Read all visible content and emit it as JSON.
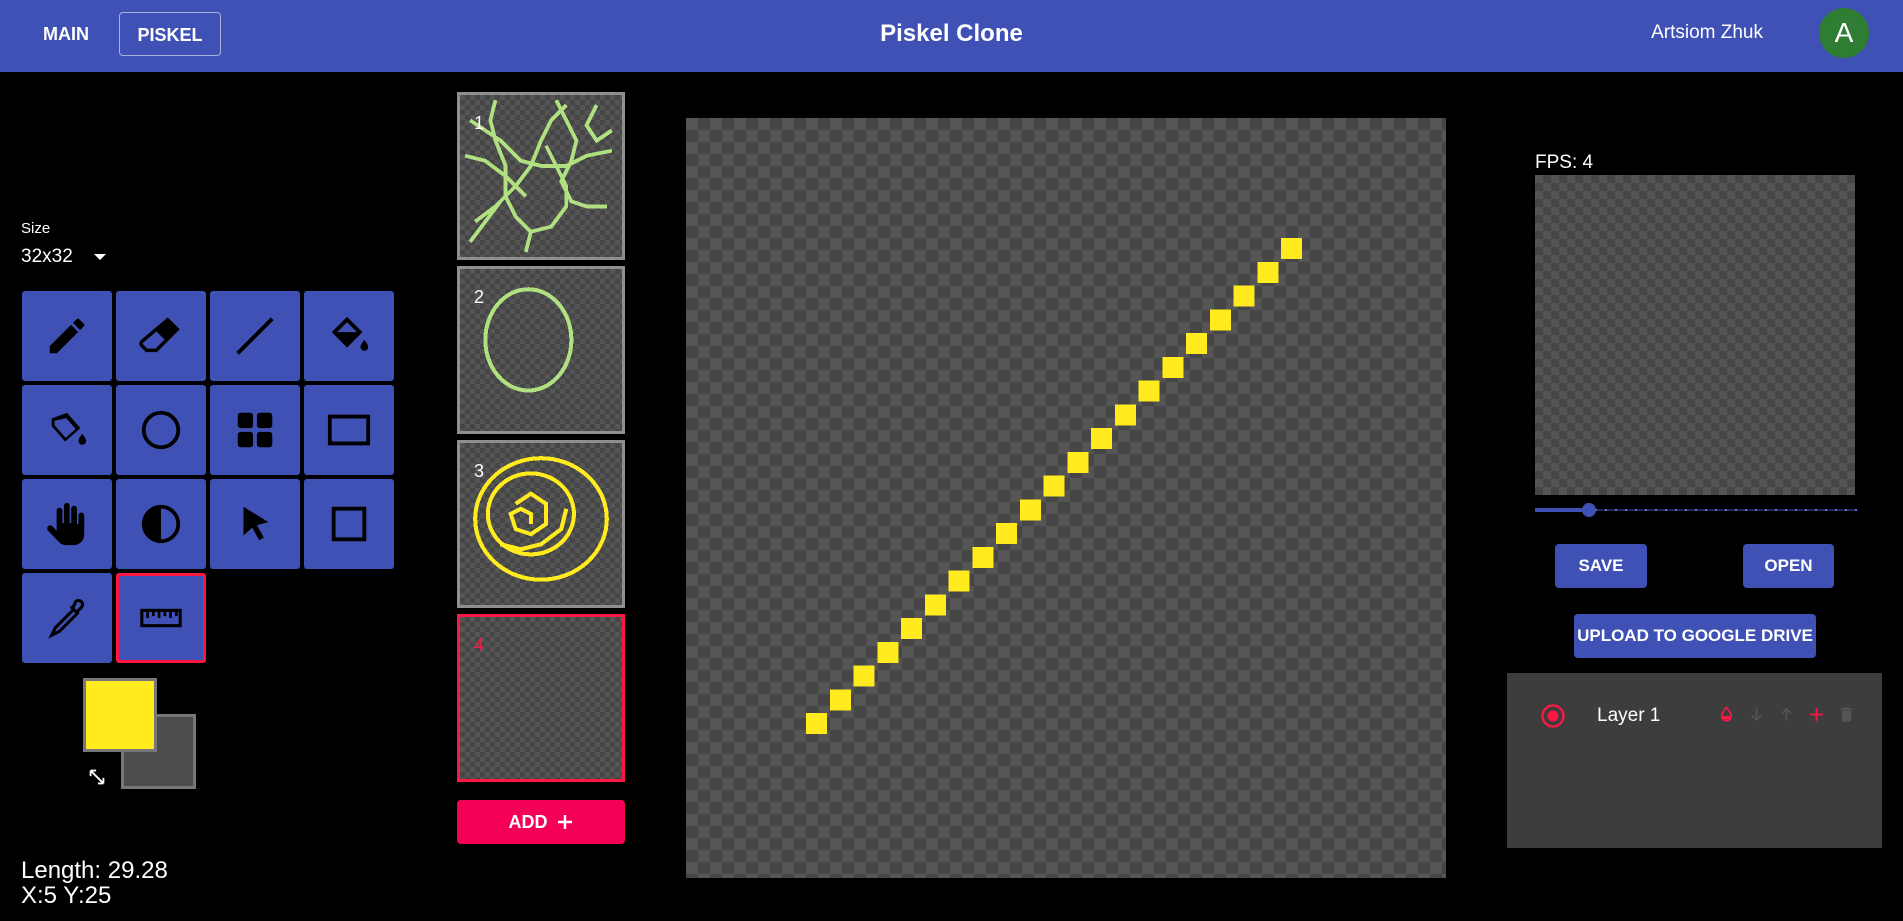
{
  "header": {
    "nav": [
      {
        "label": "MAIN"
      },
      {
        "label": "PISKEL"
      }
    ],
    "title": "Piskel Clone",
    "user_name": "Artsiom Zhuk",
    "avatar_initial": "A",
    "avatar_color": "#2e7d32",
    "bar_color": "#3f51b5"
  },
  "tools": {
    "size_label": "Size",
    "size_value": "32x32",
    "items": [
      {
        "name": "pen",
        "icon": "pencil-icon",
        "active": false
      },
      {
        "name": "eraser",
        "icon": "eraser-icon",
        "active": false
      },
      {
        "name": "stroke",
        "icon": "line-icon",
        "active": false
      },
      {
        "name": "paint-bucket",
        "icon": "paint-bucket-icon",
        "active": false
      },
      {
        "name": "paint-all-same",
        "icon": "paint-pour-icon",
        "active": false
      },
      {
        "name": "circle",
        "icon": "circle-icon",
        "active": false
      },
      {
        "name": "dithering",
        "icon": "grid-squares-icon",
        "active": false
      },
      {
        "name": "rectangle",
        "icon": "rectangle-icon",
        "active": false
      },
      {
        "name": "move",
        "icon": "hand-icon",
        "active": false
      },
      {
        "name": "lighten",
        "icon": "contrast-icon",
        "active": false
      },
      {
        "name": "select",
        "icon": "cursor-icon",
        "active": false
      },
      {
        "name": "rectangle-select",
        "icon": "selection-square-icon",
        "active": false
      },
      {
        "name": "color-picker",
        "icon": "eyedropper-icon",
        "active": false
      },
      {
        "name": "ruler",
        "icon": "ruler-icon",
        "active": true
      }
    ],
    "primary_color": "#ffeb1e",
    "secondary_color": "#4c4c4c"
  },
  "status": {
    "length": "Length: 29.28",
    "coords": "X:5 Y:25"
  },
  "frames": {
    "items": [
      {
        "number": "1",
        "active": false
      },
      {
        "number": "2",
        "active": false
      },
      {
        "number": "3",
        "active": false
      },
      {
        "number": "4",
        "active": true
      }
    ],
    "add_label": "ADD"
  },
  "canvas": {
    "grid": 32,
    "stroke_color": "#ffeb1e",
    "pixels": [
      [
        5,
        25
      ],
      [
        6,
        24
      ],
      [
        7,
        23
      ],
      [
        8,
        22
      ],
      [
        9,
        21
      ],
      [
        10,
        20
      ],
      [
        11,
        19
      ],
      [
        12,
        18
      ],
      [
        13,
        17
      ],
      [
        14,
        16
      ],
      [
        15,
        15
      ],
      [
        16,
        14
      ],
      [
        17,
        13
      ],
      [
        18,
        12
      ],
      [
        19,
        11
      ],
      [
        20,
        10
      ],
      [
        21,
        9
      ],
      [
        22,
        8
      ],
      [
        23,
        7
      ],
      [
        24,
        6
      ],
      [
        25,
        5
      ]
    ]
  },
  "preview": {
    "fps_label": "FPS: 4",
    "fps": 4,
    "fps_max": 24
  },
  "actions": {
    "save_label": "SAVE",
    "open_label": "OPEN",
    "upload_label": "UPLOAD TO GOOGLE DRIVE"
  },
  "layers": {
    "items": [
      {
        "name": "Layer 1",
        "selected": true
      }
    ],
    "accent_color": "#ff1744"
  }
}
